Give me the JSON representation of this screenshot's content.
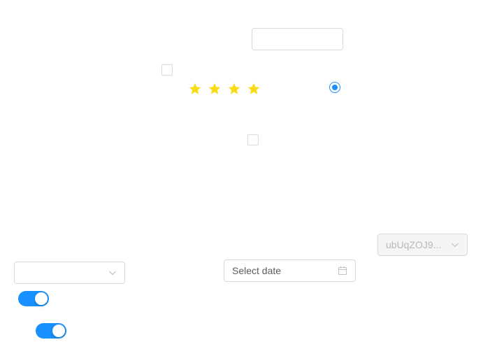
{
  "text_input": {
    "value": "",
    "placeholder": ""
  },
  "checkboxes": [
    {
      "checked": false
    },
    {
      "checked": false
    }
  ],
  "radio": {
    "checked": true,
    "color": "#1890ff"
  },
  "rating": {
    "value": 4,
    "max": 4,
    "color": "#fadb14"
  },
  "select_top_right": {
    "value": "ubUqZOJ9...",
    "disabled": true
  },
  "select_left": {
    "value": ""
  },
  "datepicker": {
    "placeholder": "Select date"
  },
  "switches": [
    {
      "on": true
    },
    {
      "on": true
    }
  ],
  "accent_color": "#1890ff"
}
